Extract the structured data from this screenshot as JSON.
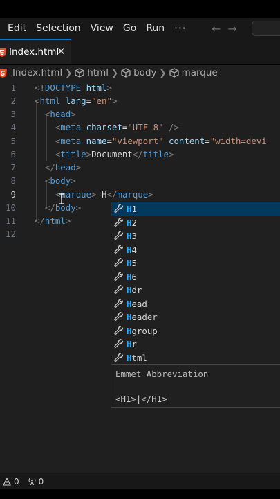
{
  "menubar": {
    "items": [
      "Edit",
      "Selection",
      "View",
      "Go",
      "Run",
      "···"
    ]
  },
  "nav": {
    "back": "←",
    "forward": "→"
  },
  "tab": {
    "label": "Index.html",
    "close": "✕"
  },
  "breadcrumb": [
    "Index.html",
    "html",
    "body",
    "marque"
  ],
  "editor": {
    "active_line": 9,
    "lines": [
      [
        {
          "c": "t-punc",
          "t": "<!"
        },
        {
          "c": "t-tag",
          "t": "DOCTYPE"
        },
        {
          "c": "t-attr",
          "t": " html"
        },
        {
          "c": "t-punc",
          "t": ">"
        }
      ],
      [
        {
          "c": "t-punc",
          "t": "<"
        },
        {
          "c": "t-tag",
          "t": "html"
        },
        {
          "c": "t-attr",
          "t": " lang"
        },
        {
          "c": "t-text",
          "t": "="
        },
        {
          "c": "t-str",
          "t": "\"en\""
        },
        {
          "c": "t-punc",
          "t": ">"
        }
      ],
      [
        {
          "c": "t-text",
          "t": "  "
        },
        {
          "c": "t-punc",
          "t": "<"
        },
        {
          "c": "t-tag",
          "t": "head"
        },
        {
          "c": "t-punc",
          "t": ">"
        }
      ],
      [
        {
          "c": "t-text",
          "t": "    "
        },
        {
          "c": "t-punc",
          "t": "<"
        },
        {
          "c": "t-tag",
          "t": "meta"
        },
        {
          "c": "t-attr",
          "t": " charset"
        },
        {
          "c": "t-text",
          "t": "="
        },
        {
          "c": "t-str",
          "t": "\"UTF-8\""
        },
        {
          "c": "t-punc",
          "t": " />"
        }
      ],
      [
        {
          "c": "t-text",
          "t": "    "
        },
        {
          "c": "t-punc",
          "t": "<"
        },
        {
          "c": "t-tag",
          "t": "meta"
        },
        {
          "c": "t-attr",
          "t": " name"
        },
        {
          "c": "t-text",
          "t": "="
        },
        {
          "c": "t-str",
          "t": "\"viewport\""
        },
        {
          "c": "t-attr",
          "t": " content"
        },
        {
          "c": "t-text",
          "t": "="
        },
        {
          "c": "t-str",
          "t": "\"width=devi"
        }
      ],
      [
        {
          "c": "t-text",
          "t": "    "
        },
        {
          "c": "t-punc",
          "t": "<"
        },
        {
          "c": "t-tag",
          "t": "title"
        },
        {
          "c": "t-punc",
          "t": ">"
        },
        {
          "c": "t-text",
          "t": "Document"
        },
        {
          "c": "t-punc",
          "t": "</"
        },
        {
          "c": "t-tag",
          "t": "title"
        },
        {
          "c": "t-punc",
          "t": ">"
        }
      ],
      [
        {
          "c": "t-text",
          "t": "  "
        },
        {
          "c": "t-punc",
          "t": "</"
        },
        {
          "c": "t-tag",
          "t": "head"
        },
        {
          "c": "t-punc",
          "t": ">"
        }
      ],
      [
        {
          "c": "t-text",
          "t": "  "
        },
        {
          "c": "t-punc",
          "t": "<"
        },
        {
          "c": "t-tag",
          "t": "body"
        },
        {
          "c": "t-punc",
          "t": ">"
        }
      ],
      [
        {
          "c": "t-text",
          "t": "    "
        },
        {
          "c": "t-punc",
          "t": "<"
        },
        {
          "c": "t-tag",
          "t": "marque"
        },
        {
          "c": "t-punc",
          "t": ">"
        },
        {
          "c": "t-text",
          "t": " H"
        },
        {
          "c": "t-punc",
          "t": "</"
        },
        {
          "c": "t-tag",
          "t": "marque"
        },
        {
          "c": "t-punc",
          "t": ">"
        }
      ],
      [
        {
          "c": "t-text",
          "t": "  "
        },
        {
          "c": "t-punc",
          "t": "</"
        },
        {
          "c": "t-tag",
          "t": "body"
        },
        {
          "c": "t-punc",
          "t": ">"
        }
      ],
      [
        {
          "c": "t-punc",
          "t": "</"
        },
        {
          "c": "t-tag",
          "t": "html"
        },
        {
          "c": "t-punc",
          "t": ">"
        }
      ],
      []
    ]
  },
  "suggest": {
    "items": [
      {
        "hl": "H",
        "rest": "1"
      },
      {
        "hl": "H",
        "rest": "2"
      },
      {
        "hl": "H",
        "rest": "3"
      },
      {
        "hl": "H",
        "rest": "4"
      },
      {
        "hl": "H",
        "rest": "5"
      },
      {
        "hl": "H",
        "rest": "6"
      },
      {
        "hl": "H",
        "rest": "dr"
      },
      {
        "hl": "H",
        "rest": "ead"
      },
      {
        "hl": "H",
        "rest": "eader"
      },
      {
        "hl": "H",
        "rest": "group"
      },
      {
        "hl": "H",
        "rest": "r"
      },
      {
        "hl": "H",
        "rest": "tml"
      }
    ],
    "selected_index": 0,
    "detail_title": "Emmet Abbreviation",
    "detail_body": "<H1>|</H1>"
  },
  "status": {
    "problems": "0",
    "ports": "0"
  },
  "colors": {
    "accent": "#0078d4",
    "highlight": "#2aaaff",
    "selection": "#04395e",
    "html_icon": "#e44d26"
  }
}
